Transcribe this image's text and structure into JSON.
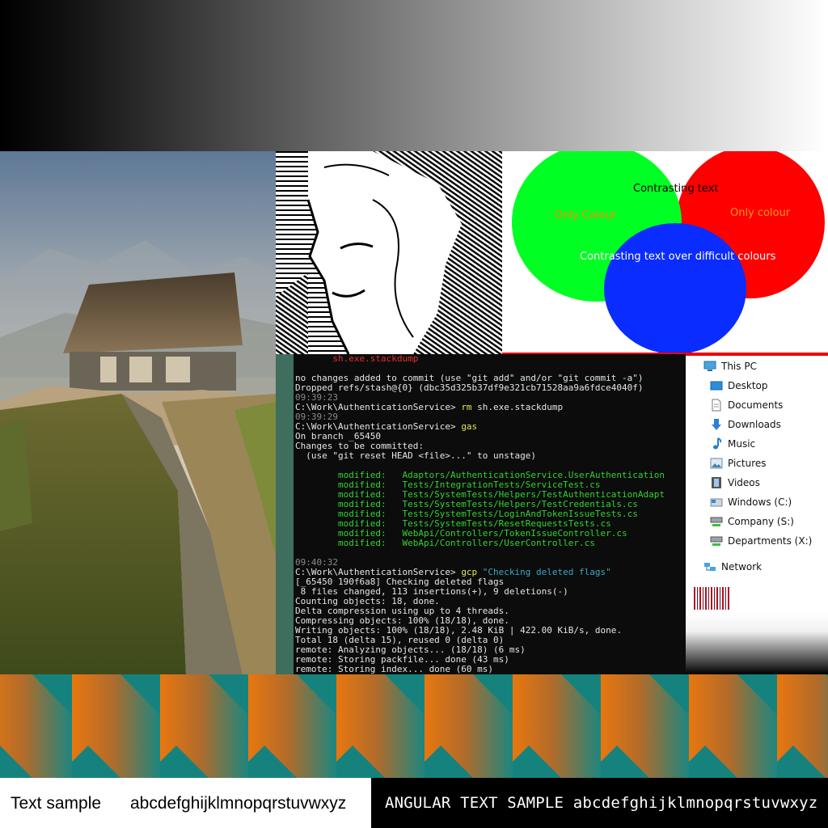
{
  "venn": {
    "label_top": "Contrasting text",
    "label_left": "Only Colour",
    "label_right": "Only colour",
    "label_bottom": "Contrasting text over difficult colours",
    "colors": {
      "green": "#00ff22",
      "red": "#ff0000",
      "blue": "#0a2cff",
      "orange_text": "#ff8c00"
    }
  },
  "terminal": {
    "lines": [
      {
        "text": "       sh.exe.stackdump",
        "cls": "c-red"
      },
      {
        "text": "",
        "cls": ""
      },
      {
        "text": "no changes added to commit (use \"git add\" and/or \"git commit -a\")",
        "cls": ""
      },
      {
        "text": "Dropped refs/stash@{0} (dbc35d325b37df9e321cb71528aa9a6fdce4040f)",
        "cls": ""
      },
      {
        "text": "09:39:23",
        "cls": "c-gray"
      },
      {
        "html_prompt": "C:\\Work\\AuthenticationService> ",
        "cmd": "rm",
        "rest": " sh.exe.stackdump"
      },
      {
        "text": "09:39:29",
        "cls": "c-gray"
      },
      {
        "html_prompt": "C:\\Work\\AuthenticationService> ",
        "cmd": "gas",
        "rest": ""
      },
      {
        "text": "On branch _65450",
        "cls": ""
      },
      {
        "text": "Changes to be committed:",
        "cls": ""
      },
      {
        "text": "  (use \"git reset HEAD <file>...\" to unstage)",
        "cls": ""
      },
      {
        "text": "",
        "cls": ""
      },
      {
        "text": "        modified:   Adaptors/AuthenticationService.UserAuthentication",
        "cls": "c-green"
      },
      {
        "text": "        modified:   Tests/IntegrationTests/ServiceTest.cs",
        "cls": "c-green"
      },
      {
        "text": "        modified:   Tests/SystemTests/Helpers/TestAuthenticationAdapt",
        "cls": "c-green"
      },
      {
        "text": "        modified:   Tests/SystemTests/Helpers/TestCredentials.cs",
        "cls": "c-green"
      },
      {
        "text": "        modified:   Tests/SystemTests/LoginAndTokenIssueTests.cs",
        "cls": "c-green"
      },
      {
        "text": "        modified:   Tests/SystemTests/ResetRequestsTests.cs",
        "cls": "c-green"
      },
      {
        "text": "        modified:   WebApi/Controllers/TokenIssueController.cs",
        "cls": "c-green"
      },
      {
        "text": "        modified:   WebApi/Controllers/UserController.cs",
        "cls": "c-green"
      },
      {
        "text": "",
        "cls": ""
      },
      {
        "text": "09:40:32",
        "cls": "c-gray"
      },
      {
        "html_prompt": "C:\\Work\\AuthenticationService> ",
        "cmd": "gcp",
        "rest": " \"Checking deleted flags\"",
        "rest_cls": "c-cyan"
      },
      {
        "text": "[_65450 190f6a8] Checking deleted flags",
        "cls": ""
      },
      {
        "text": " 8 files changed, 113 insertions(+), 9 deletions(-)",
        "cls": ""
      },
      {
        "text": "Counting objects: 18, done.",
        "cls": ""
      },
      {
        "text": "Delta compression using up to 4 threads.",
        "cls": ""
      },
      {
        "text": "Compressing objects: 100% (18/18), done.",
        "cls": ""
      },
      {
        "text": "Writing objects: 100% (18/18), 2.48 KiB | 422.00 KiB/s, done.",
        "cls": ""
      },
      {
        "text": "Total 18 (delta 15), reused 0 (delta 0)",
        "cls": ""
      },
      {
        "text": "remote: Analyzing objects... (18/18) (6 ms)",
        "cls": ""
      },
      {
        "text": "remote: Storing packfile... done (43 ms)",
        "cls": ""
      },
      {
        "text": "remote: Storing index... done (60 ms)",
        "cls": ""
      }
    ]
  },
  "explorer": {
    "items": [
      {
        "label": "This PC",
        "icon": "monitor-icon",
        "indent": 22
      },
      {
        "label": "Desktop",
        "icon": "desktop-icon",
        "indent": 30
      },
      {
        "label": "Documents",
        "icon": "document-icon",
        "indent": 30
      },
      {
        "label": "Downloads",
        "icon": "download-arrow-icon",
        "indent": 30
      },
      {
        "label": "Music",
        "icon": "music-note-icon",
        "indent": 30
      },
      {
        "label": "Pictures",
        "icon": "picture-icon",
        "indent": 30
      },
      {
        "label": "Videos",
        "icon": "film-icon",
        "indent": 30
      },
      {
        "label": "Windows (C:)",
        "icon": "drive-icon",
        "indent": 30
      },
      {
        "label": "Company (S:)",
        "icon": "network-drive-icon",
        "indent": 30
      },
      {
        "label": "Departments (X:)",
        "icon": "network-drive-icon",
        "indent": 30
      },
      {
        "label": "Network",
        "icon": "network-icon",
        "indent": 22
      }
    ]
  },
  "text_sample": {
    "left_label": "Text sample",
    "left_alphabet": "abcdefghijklmnopqrstuvwxyz",
    "right_label": "ANGULAR TEXT SAMPLE abcdefghijklmnopqrstuvwxyz"
  }
}
